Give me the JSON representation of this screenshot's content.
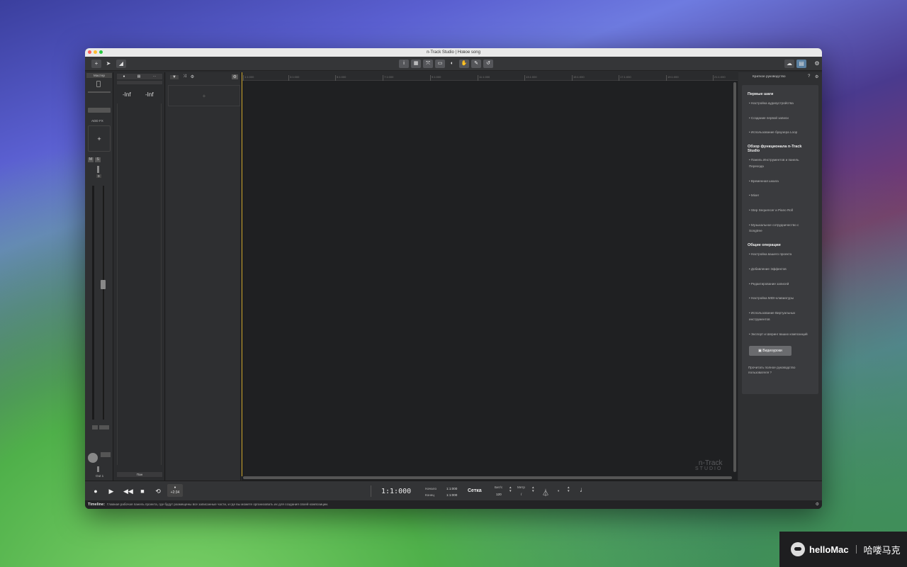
{
  "window": {
    "title": "n-Track Studio | Новое song"
  },
  "toolbar": {
    "center_tools": [
      "i",
      "▦",
      "⤧",
      "▭",
      "◐",
      "✋",
      "✎",
      "↺"
    ]
  },
  "master": {
    "label": "Мастер",
    "fx_label": "ADD FX",
    "plus": "+",
    "zero": "0",
    "out_label": "Out 1"
  },
  "mixer": {
    "left_level": "-Inf",
    "right_level": "-Inf",
    "footer_label": "Пан"
  },
  "tracklist": {
    "add_track": "+"
  },
  "ruler": {
    "ticks": [
      "1:1:000",
      "3:1:000",
      "5:1:000",
      "7:1:000",
      "9:1:000",
      "11:1:000",
      "13:1:000",
      "15:1:000",
      "17:1:000",
      "19:1:000",
      "21:1:000"
    ]
  },
  "watermark": {
    "line1": "n-Track",
    "line2": "STUDIO"
  },
  "right_panel": {
    "header": "Краткое руководство",
    "sections": [
      {
        "title": "Первые шаги",
        "items": [
          "Настройка аудиоустройства",
          "Создание первой записи",
          "Использование браузера Loop"
        ]
      },
      {
        "title": "Обзор функционала n-Track Studio",
        "items": [
          "Панель Инструментов и панель Перехода",
          "Временная шкала",
          "Mixer",
          "Step Sequencer и Piano Roll",
          "Музыкальное сотрудничество с Songtree"
        ]
      },
      {
        "title": "Общие операции",
        "items": [
          "Настройка вашего проекта",
          "Добавление Эффектов",
          "Редактирование записей",
          "Настройка MIDI-клавиатуры",
          "Использование Виртуальных инструментов",
          "Экспорт и Шеринг ваших композиций"
        ]
      }
    ],
    "video_button": "Видеоуроки",
    "full_guide": "Прочитать полное руководство пользователя"
  },
  "transport": {
    "record_badge": "+2:34",
    "position": "1:1:000",
    "start_label": "Начало",
    "start_value": "1:1:000",
    "end_label": "Конец",
    "end_value": "1:1:000",
    "grid_label": "Сетка",
    "tempo_label": "Бит/с",
    "tempo_value": "120",
    "meter_label": "Метр",
    "meter_value": "/"
  },
  "status": {
    "label": "Timeline:",
    "text": "Главная рабочая панель проекта, где будут размещены все записанные части, и где вы можете организовать их для создания своей композиции."
  },
  "badge": {
    "brand": "helloMac",
    "cn": "哈喽马克"
  }
}
